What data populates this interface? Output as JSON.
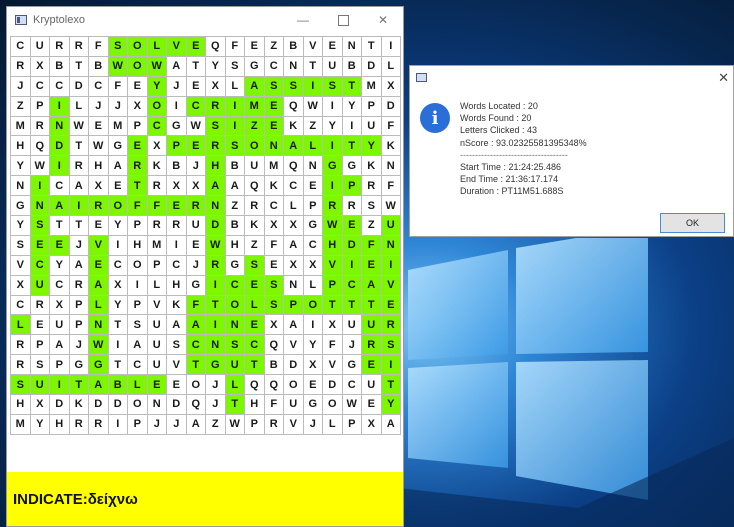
{
  "window": {
    "title": "Kryptolexo",
    "minimize_glyph": "—",
    "close_glyph": "✕"
  },
  "grid": {
    "rows": [
      [
        "C",
        "U",
        "R",
        "R",
        "F",
        "S",
        "O",
        "L",
        "V",
        "E",
        "Q",
        "F",
        "E",
        "Z",
        "B",
        "V",
        "E",
        "N",
        "T",
        "I"
      ],
      [
        "R",
        "X",
        "B",
        "T",
        "B",
        "W",
        "O",
        "W",
        "A",
        "T",
        "Y",
        "S",
        "G",
        "C",
        "N",
        "T",
        "U",
        "B",
        "D",
        "L"
      ],
      [
        "J",
        "C",
        "C",
        "D",
        "C",
        "F",
        "E",
        "Y",
        "J",
        "E",
        "X",
        "L",
        "A",
        "S",
        "S",
        "I",
        "S",
        "T",
        "M",
        "X"
      ],
      [
        "Z",
        "P",
        "I",
        "L",
        "J",
        "J",
        "X",
        "O",
        "I",
        "C",
        "R",
        "I",
        "M",
        "E",
        "Q",
        "W",
        "I",
        "Y",
        "P",
        "D"
      ],
      [
        "M",
        "R",
        "N",
        "W",
        "E",
        "M",
        "P",
        "C",
        "G",
        "W",
        "S",
        "I",
        "Z",
        "E",
        "K",
        "Z",
        "Y",
        "I",
        "U",
        "F"
      ],
      [
        "H",
        "Q",
        "D",
        "T",
        "W",
        "G",
        "E",
        "X",
        "P",
        "E",
        "R",
        "S",
        "O",
        "N",
        "A",
        "L",
        "I",
        "T",
        "Y",
        "K"
      ],
      [
        "Y",
        "W",
        "I",
        "R",
        "H",
        "A",
        "R",
        "K",
        "B",
        "J",
        "H",
        "B",
        "U",
        "M",
        "Q",
        "N",
        "G",
        "G",
        "K",
        "N"
      ],
      [
        "N",
        "I",
        "C",
        "A",
        "X",
        "E",
        "T",
        "R",
        "X",
        "X",
        "A",
        "A",
        "Q",
        "K",
        "C",
        "E",
        "I",
        "P",
        "R",
        "F"
      ],
      [
        "G",
        "N",
        "A",
        "I",
        "R",
        "O",
        "F",
        "F",
        "E",
        "R",
        "N",
        "Z",
        "R",
        "C",
        "L",
        "P",
        "R",
        "R",
        "S",
        "W"
      ],
      [
        "Y",
        "S",
        "T",
        "T",
        "E",
        "Y",
        "P",
        "R",
        "R",
        "U",
        "D",
        "B",
        "K",
        "X",
        "X",
        "G",
        "W",
        "E",
        "Z",
        "U"
      ],
      [
        "S",
        "E",
        "E",
        "J",
        "V",
        "I",
        "H",
        "M",
        "I",
        "E",
        "W",
        "H",
        "Z",
        "F",
        "A",
        "C",
        "H",
        "D",
        "F",
        "N"
      ],
      [
        "V",
        "C",
        "Y",
        "A",
        "E",
        "C",
        "O",
        "P",
        "C",
        "J",
        "R",
        "G",
        "S",
        "E",
        "X",
        "X",
        "V",
        "I",
        "E",
        "I"
      ],
      [
        "X",
        "U",
        "C",
        "R",
        "A",
        "X",
        "I",
        "L",
        "H",
        "G",
        "I",
        "C",
        "E",
        "S",
        "N",
        "L",
        "P",
        "C",
        "A",
        "V"
      ],
      [
        "C",
        "R",
        "X",
        "P",
        "L",
        "Y",
        "P",
        "V",
        "K",
        "F",
        "T",
        "O",
        "L",
        "S",
        "P",
        "O",
        "T",
        "T",
        "T",
        "E"
      ],
      [
        "L",
        "E",
        "U",
        "P",
        "N",
        "T",
        "S",
        "U",
        "A",
        "A",
        "I",
        "N",
        "E",
        "X",
        "A",
        "I",
        "X",
        "U",
        "U",
        "R"
      ],
      [
        "R",
        "P",
        "A",
        "J",
        "W",
        "I",
        "A",
        "U",
        "S",
        "C",
        "N",
        "S",
        "C",
        "Q",
        "V",
        "Y",
        "F",
        "J",
        "R",
        "S"
      ],
      [
        "R",
        "S",
        "P",
        "G",
        "G",
        "T",
        "C",
        "U",
        "V",
        "T",
        "G",
        "U",
        "T",
        "B",
        "D",
        "X",
        "V",
        "G",
        "E",
        "I"
      ],
      [
        "S",
        "U",
        "I",
        "T",
        "A",
        "B",
        "L",
        "E",
        "E",
        "O",
        "J",
        "L",
        "Q",
        "Q",
        "O",
        "E",
        "D",
        "C",
        "U",
        "T"
      ],
      [
        "H",
        "X",
        "D",
        "K",
        "D",
        "D",
        "O",
        "N",
        "D",
        "Q",
        "J",
        "T",
        "H",
        "F",
        "U",
        "G",
        "O",
        "W",
        "E",
        "Y"
      ],
      [
        "M",
        "Y",
        "H",
        "R",
        "R",
        "I",
        "P",
        "J",
        "J",
        "A",
        "Z",
        "W",
        "P",
        "R",
        "V",
        "J",
        "L",
        "P",
        "X",
        "A"
      ]
    ],
    "highlighted": [
      [
        0,
        5
      ],
      [
        0,
        6
      ],
      [
        0,
        7
      ],
      [
        0,
        8
      ],
      [
        0,
        9
      ],
      [
        1,
        5
      ],
      [
        1,
        6
      ],
      [
        1,
        7
      ],
      [
        2,
        7
      ],
      [
        2,
        12
      ],
      [
        2,
        13
      ],
      [
        2,
        14
      ],
      [
        2,
        15
      ],
      [
        2,
        16
      ],
      [
        2,
        17
      ],
      [
        3,
        2
      ],
      [
        3,
        7
      ],
      [
        3,
        9
      ],
      [
        3,
        10
      ],
      [
        3,
        11
      ],
      [
        3,
        12
      ],
      [
        3,
        13
      ],
      [
        4,
        2
      ],
      [
        4,
        7
      ],
      [
        4,
        10
      ],
      [
        4,
        11
      ],
      [
        4,
        12
      ],
      [
        4,
        13
      ],
      [
        5,
        2
      ],
      [
        5,
        6
      ],
      [
        5,
        8
      ],
      [
        5,
        9
      ],
      [
        5,
        10
      ],
      [
        5,
        11
      ],
      [
        5,
        12
      ],
      [
        5,
        13
      ],
      [
        5,
        14
      ],
      [
        5,
        15
      ],
      [
        5,
        16
      ],
      [
        5,
        17
      ],
      [
        5,
        18
      ],
      [
        6,
        2
      ],
      [
        6,
        6
      ],
      [
        6,
        10
      ],
      [
        6,
        16
      ],
      [
        7,
        1
      ],
      [
        7,
        6
      ],
      [
        7,
        10
      ],
      [
        7,
        16
      ],
      [
        7,
        17
      ],
      [
        8,
        1
      ],
      [
        8,
        2
      ],
      [
        8,
        3
      ],
      [
        8,
        4
      ],
      [
        8,
        5
      ],
      [
        8,
        6
      ],
      [
        8,
        7
      ],
      [
        8,
        8
      ],
      [
        8,
        9
      ],
      [
        8,
        10
      ],
      [
        8,
        16
      ],
      [
        9,
        1
      ],
      [
        9,
        10
      ],
      [
        9,
        16
      ],
      [
        9,
        17
      ],
      [
        9,
        19
      ],
      [
        10,
        1
      ],
      [
        10,
        2
      ],
      [
        10,
        4
      ],
      [
        10,
        10
      ],
      [
        10,
        16
      ],
      [
        10,
        17
      ],
      [
        10,
        18
      ],
      [
        10,
        19
      ],
      [
        11,
        1
      ],
      [
        11,
        4
      ],
      [
        11,
        10
      ],
      [
        11,
        12
      ],
      [
        11,
        16
      ],
      [
        11,
        17
      ],
      [
        11,
        18
      ],
      [
        11,
        19
      ],
      [
        12,
        1
      ],
      [
        12,
        4
      ],
      [
        12,
        10
      ],
      [
        12,
        11
      ],
      [
        12,
        12
      ],
      [
        12,
        13
      ],
      [
        12,
        16
      ],
      [
        12,
        17
      ],
      [
        12,
        18
      ],
      [
        12,
        19
      ],
      [
        13,
        4
      ],
      [
        13,
        9
      ],
      [
        13,
        10
      ],
      [
        13,
        11
      ],
      [
        13,
        12
      ],
      [
        13,
        13
      ],
      [
        13,
        14
      ],
      [
        13,
        15
      ],
      [
        13,
        16
      ],
      [
        13,
        17
      ],
      [
        13,
        18
      ],
      [
        13,
        19
      ],
      [
        14,
        0
      ],
      [
        14,
        4
      ],
      [
        14,
        9
      ],
      [
        14,
        10
      ],
      [
        14,
        11
      ],
      [
        14,
        12
      ],
      [
        14,
        18
      ],
      [
        14,
        19
      ],
      [
        15,
        4
      ],
      [
        15,
        9
      ],
      [
        15,
        10
      ],
      [
        15,
        11
      ],
      [
        15,
        12
      ],
      [
        15,
        18
      ],
      [
        15,
        19
      ],
      [
        16,
        4
      ],
      [
        16,
        9
      ],
      [
        16,
        10
      ],
      [
        16,
        11
      ],
      [
        16,
        12
      ],
      [
        16,
        18
      ],
      [
        16,
        19
      ],
      [
        17,
        0
      ],
      [
        17,
        1
      ],
      [
        17,
        2
      ],
      [
        17,
        3
      ],
      [
        17,
        4
      ],
      [
        17,
        5
      ],
      [
        17,
        6
      ],
      [
        17,
        7
      ],
      [
        17,
        11
      ],
      [
        17,
        19
      ],
      [
        18,
        11
      ],
      [
        18,
        19
      ]
    ]
  },
  "hint": {
    "text": "INDICATE:δείχνω"
  },
  "colors": {
    "highlight": "#7cf700",
    "hint_bg": "#ffff00",
    "info_icon": "#2a6fd6"
  },
  "dialog": {
    "close_glyph": "✕",
    "info_glyph": "i",
    "words_located": "Words Located : 20",
    "words_found": "Words Found : 20",
    "letters_clicked": "Letters Clicked : 43",
    "nscore": "nScore : 93.02325581395348%",
    "separator": "------------------------------------",
    "start_time": "Start Time : 21:24:25.486",
    "end_time": "End Time : 21:36:17.174",
    "duration": "Duration : PT11M51.688S",
    "ok_label": "OK"
  }
}
